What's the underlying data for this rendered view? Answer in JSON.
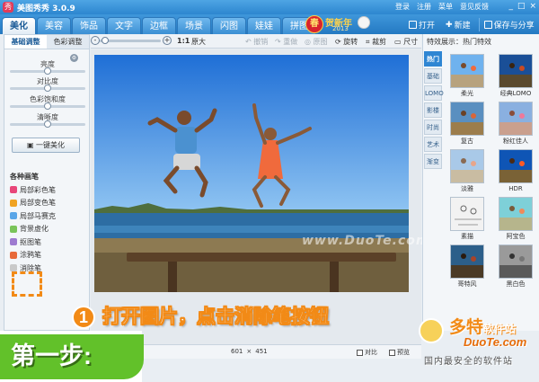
{
  "app": {
    "title": "美图秀秀 3.0.9",
    "logo_glyph": "秀"
  },
  "title_links": [
    "登录",
    "注册",
    "菜单",
    "意见反馈"
  ],
  "window_buttons": [
    "_",
    "□",
    "×"
  ],
  "main_tabs": [
    "美化",
    "美容",
    "饰品",
    "文字",
    "边框",
    "场景",
    "闪图",
    "娃娃",
    "拼图"
  ],
  "banner": {
    "chun": "春",
    "text": "贺新年",
    "year": "2013"
  },
  "nav_actions": {
    "open": "打开",
    "new": "新建",
    "save": "保存与分享"
  },
  "left_panel": {
    "tabs": [
      "基础调整",
      "色彩调整"
    ],
    "sliders": [
      {
        "label": "亮度",
        "value": 0.5
      },
      {
        "label": "对比度",
        "value": 0.5
      },
      {
        "label": "色彩饱和度",
        "value": 0.5
      },
      {
        "label": "清晰度",
        "value": 0.5
      }
    ],
    "beautify_button": "一键美化",
    "brush_header": "各种画笔",
    "brushes": [
      "局部彩色笔",
      "局部变色笔",
      "局部马赛克",
      "背景虚化",
      "抠图笔",
      "涂鸦笔",
      "消除笔"
    ]
  },
  "toolbar": {
    "zoom_out": "-",
    "zoom_in": "+",
    "zoom_level": "1:1",
    "original_size": "原大",
    "undo": "撤销",
    "redo": "重做",
    "reset": "原图",
    "rotate": "旋转",
    "crop": "裁剪",
    "size": "尺寸"
  },
  "canvas": {
    "photo_width": "601",
    "times": "×",
    "photo_height": "451",
    "watermark": "www.DuoTe.com",
    "compare": "对比",
    "preview": "预览"
  },
  "right_panel": {
    "header": "特效展示：热门特效",
    "tabs": [
      "热门",
      "基础",
      "LOMO",
      "影楼",
      "时尚",
      "艺术",
      "渐变"
    ],
    "effects": [
      "柔光",
      "经典LOMO",
      "复古",
      "粉红佳人",
      "淡雅",
      "HDR",
      "素描",
      "阿宝色",
      "哥特风",
      "黑白色"
    ]
  },
  "overlay": {
    "step_number": "1",
    "instruction": "打开图片，点击消除笔按钮",
    "step_badge": "第一步:",
    "brand_title": "多特",
    "brand_title_small": "软件站",
    "brand_domain": "DuoTe.com",
    "brand_tagline": "国内最安全的软件站"
  },
  "colors": {
    "accent_blue": "#2f86d3",
    "highlight_orange": "#f28a16",
    "step_green": "#62c12a"
  }
}
